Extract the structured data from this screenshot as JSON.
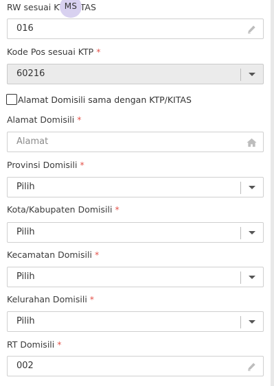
{
  "avatar": {
    "initials": "MS"
  },
  "fields": {
    "rw_ktp": {
      "label": "RW sesuai KTP/KITAS",
      "value": "016",
      "icon": "pencil-icon"
    },
    "kode_pos_ktp": {
      "label": "Kode Pos sesuai KTP",
      "value": "60216"
    },
    "same_address": {
      "label": "Alamat Domisili sama dengan KTP/KITAS",
      "checked": false
    },
    "alamat_domisili": {
      "label": "Alamat Domisili",
      "placeholder": "Alamat",
      "icon": "home-icon"
    },
    "provinsi_domisili": {
      "label": "Provinsi Domisili",
      "value": "Pilih"
    },
    "kota_domisili": {
      "label": "Kota/Kabupaten Domisili",
      "value": "Pilih"
    },
    "kecamatan_domisili": {
      "label": "Kecamatan Domisili",
      "value": "Pilih"
    },
    "kelurahan_domisili": {
      "label": "Kelurahan Domisili",
      "value": "Pilih"
    },
    "rt_domisili": {
      "label": "RT Domisili",
      "value": "002",
      "icon": "pencil-icon"
    }
  },
  "required_marker": "*",
  "colors": {
    "required": "#e5534b",
    "avatar_bg": "#d8d1f0",
    "disabled_bg": "#ebebeb"
  }
}
